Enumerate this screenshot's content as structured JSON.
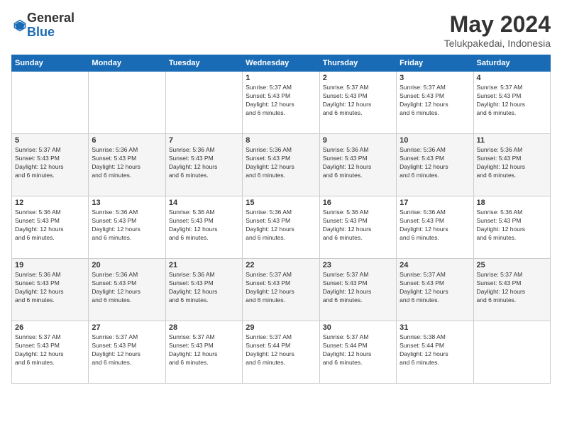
{
  "header": {
    "logo_general": "General",
    "logo_blue": "Blue",
    "month_title": "May 2024",
    "location": "Telukpakedai, Indonesia"
  },
  "weekdays": [
    "Sunday",
    "Monday",
    "Tuesday",
    "Wednesday",
    "Thursday",
    "Friday",
    "Saturday"
  ],
  "weeks": [
    [
      {
        "day": "",
        "text": ""
      },
      {
        "day": "",
        "text": ""
      },
      {
        "day": "",
        "text": ""
      },
      {
        "day": "1",
        "text": "Sunrise: 5:37 AM\nSunset: 5:43 PM\nDaylight: 12 hours\nand 6 minutes."
      },
      {
        "day": "2",
        "text": "Sunrise: 5:37 AM\nSunset: 5:43 PM\nDaylight: 12 hours\nand 6 minutes."
      },
      {
        "day": "3",
        "text": "Sunrise: 5:37 AM\nSunset: 5:43 PM\nDaylight: 12 hours\nand 6 minutes."
      },
      {
        "day": "4",
        "text": "Sunrise: 5:37 AM\nSunset: 5:43 PM\nDaylight: 12 hours\nand 6 minutes."
      }
    ],
    [
      {
        "day": "5",
        "text": "Sunrise: 5:37 AM\nSunset: 5:43 PM\nDaylight: 12 hours\nand 6 minutes."
      },
      {
        "day": "6",
        "text": "Sunrise: 5:36 AM\nSunset: 5:43 PM\nDaylight: 12 hours\nand 6 minutes."
      },
      {
        "day": "7",
        "text": "Sunrise: 5:36 AM\nSunset: 5:43 PM\nDaylight: 12 hours\nand 6 minutes."
      },
      {
        "day": "8",
        "text": "Sunrise: 5:36 AM\nSunset: 5:43 PM\nDaylight: 12 hours\nand 6 minutes."
      },
      {
        "day": "9",
        "text": "Sunrise: 5:36 AM\nSunset: 5:43 PM\nDaylight: 12 hours\nand 6 minutes."
      },
      {
        "day": "10",
        "text": "Sunrise: 5:36 AM\nSunset: 5:43 PM\nDaylight: 12 hours\nand 6 minutes."
      },
      {
        "day": "11",
        "text": "Sunrise: 5:36 AM\nSunset: 5:43 PM\nDaylight: 12 hours\nand 6 minutes."
      }
    ],
    [
      {
        "day": "12",
        "text": "Sunrise: 5:36 AM\nSunset: 5:43 PM\nDaylight: 12 hours\nand 6 minutes."
      },
      {
        "day": "13",
        "text": "Sunrise: 5:36 AM\nSunset: 5:43 PM\nDaylight: 12 hours\nand 6 minutes."
      },
      {
        "day": "14",
        "text": "Sunrise: 5:36 AM\nSunset: 5:43 PM\nDaylight: 12 hours\nand 6 minutes."
      },
      {
        "day": "15",
        "text": "Sunrise: 5:36 AM\nSunset: 5:43 PM\nDaylight: 12 hours\nand 6 minutes."
      },
      {
        "day": "16",
        "text": "Sunrise: 5:36 AM\nSunset: 5:43 PM\nDaylight: 12 hours\nand 6 minutes."
      },
      {
        "day": "17",
        "text": "Sunrise: 5:36 AM\nSunset: 5:43 PM\nDaylight: 12 hours\nand 6 minutes."
      },
      {
        "day": "18",
        "text": "Sunrise: 5:36 AM\nSunset: 5:43 PM\nDaylight: 12 hours\nand 6 minutes."
      }
    ],
    [
      {
        "day": "19",
        "text": "Sunrise: 5:36 AM\nSunset: 5:43 PM\nDaylight: 12 hours\nand 6 minutes."
      },
      {
        "day": "20",
        "text": "Sunrise: 5:36 AM\nSunset: 5:43 PM\nDaylight: 12 hours\nand 6 minutes."
      },
      {
        "day": "21",
        "text": "Sunrise: 5:36 AM\nSunset: 5:43 PM\nDaylight: 12 hours\nand 6 minutes."
      },
      {
        "day": "22",
        "text": "Sunrise: 5:37 AM\nSunset: 5:43 PM\nDaylight: 12 hours\nand 6 minutes."
      },
      {
        "day": "23",
        "text": "Sunrise: 5:37 AM\nSunset: 5:43 PM\nDaylight: 12 hours\nand 6 minutes."
      },
      {
        "day": "24",
        "text": "Sunrise: 5:37 AM\nSunset: 5:43 PM\nDaylight: 12 hours\nand 6 minutes."
      },
      {
        "day": "25",
        "text": "Sunrise: 5:37 AM\nSunset: 5:43 PM\nDaylight: 12 hours\nand 6 minutes."
      }
    ],
    [
      {
        "day": "26",
        "text": "Sunrise: 5:37 AM\nSunset: 5:43 PM\nDaylight: 12 hours\nand 6 minutes."
      },
      {
        "day": "27",
        "text": "Sunrise: 5:37 AM\nSunset: 5:43 PM\nDaylight: 12 hours\nand 6 minutes."
      },
      {
        "day": "28",
        "text": "Sunrise: 5:37 AM\nSunset: 5:43 PM\nDaylight: 12 hours\nand 6 minutes."
      },
      {
        "day": "29",
        "text": "Sunrise: 5:37 AM\nSunset: 5:44 PM\nDaylight: 12 hours\nand 6 minutes."
      },
      {
        "day": "30",
        "text": "Sunrise: 5:37 AM\nSunset: 5:44 PM\nDaylight: 12 hours\nand 6 minutes."
      },
      {
        "day": "31",
        "text": "Sunrise: 5:38 AM\nSunset: 5:44 PM\nDaylight: 12 hours\nand 6 minutes."
      },
      {
        "day": "",
        "text": ""
      }
    ]
  ]
}
